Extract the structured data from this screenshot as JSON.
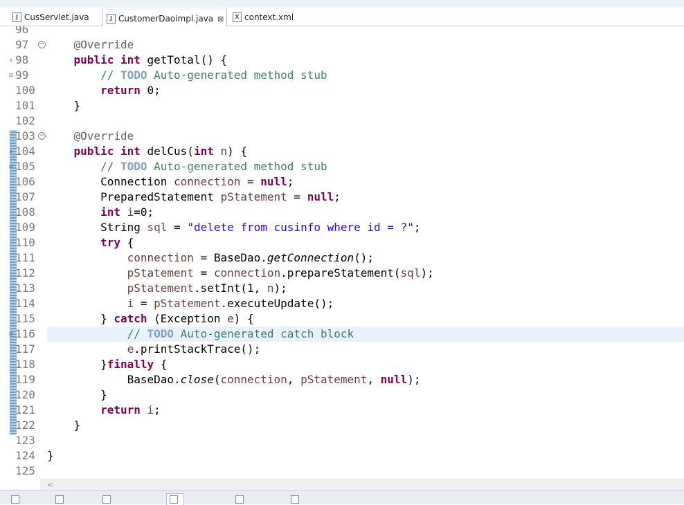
{
  "tabs": [
    {
      "label": "CusServlet.java",
      "icon": "java-file-icon",
      "active": false
    },
    {
      "label": "CustomerDaoimpl.java",
      "icon": "java-file-icon",
      "active": true,
      "close": "⊠"
    },
    {
      "label": "context.xml",
      "icon": "xml-file-icon",
      "active": false
    }
  ],
  "editor": {
    "current_line": "116",
    "lines": [
      {
        "num": "96",
        "code": ""
      },
      {
        "num": "97",
        "fold": "−",
        "tokens": [
          {
            "t": "    "
          },
          {
            "t": "@Override",
            "c": "an"
          }
        ]
      },
      {
        "num": "98",
        "marker": "▵",
        "tokens": [
          {
            "t": "    "
          },
          {
            "t": "public",
            "c": "kw"
          },
          {
            "t": " "
          },
          {
            "t": "int",
            "c": "kw"
          },
          {
            "t": " getTotal() {"
          }
        ]
      },
      {
        "num": "99",
        "marker": "☑",
        "tokens": [
          {
            "t": "        "
          },
          {
            "t": "// ",
            "c": "cm"
          },
          {
            "t": "TODO",
            "c": "todo"
          },
          {
            "t": " Auto-generated method stub",
            "c": "cm"
          }
        ]
      },
      {
        "num": "100",
        "tokens": [
          {
            "t": "        "
          },
          {
            "t": "return",
            "c": "kw"
          },
          {
            "t": " 0;"
          }
        ]
      },
      {
        "num": "101",
        "tokens": [
          {
            "t": "    }"
          }
        ]
      },
      {
        "num": "102",
        "tokens": []
      },
      {
        "num": "103",
        "fold": "−",
        "tokens": [
          {
            "t": "    "
          },
          {
            "t": "@Override",
            "c": "an"
          }
        ]
      },
      {
        "num": "104",
        "marker": "▵",
        "tokens": [
          {
            "t": "    "
          },
          {
            "t": "public",
            "c": "kw"
          },
          {
            "t": " "
          },
          {
            "t": "int",
            "c": "kw"
          },
          {
            "t": " delCus("
          },
          {
            "t": "int",
            "c": "kw"
          },
          {
            "t": " "
          },
          {
            "t": "n",
            "c": "va"
          },
          {
            "t": ") {"
          }
        ]
      },
      {
        "num": "105",
        "marker": "☑",
        "tokens": [
          {
            "t": "        "
          },
          {
            "t": "// ",
            "c": "cm"
          },
          {
            "t": "TODO",
            "c": "todo"
          },
          {
            "t": " Auto-generated method stub",
            "c": "cm"
          }
        ]
      },
      {
        "num": "106",
        "tokens": [
          {
            "t": "        Connection "
          },
          {
            "t": "connection",
            "c": "va"
          },
          {
            "t": " = "
          },
          {
            "t": "null",
            "c": "kw"
          },
          {
            "t": ";"
          }
        ]
      },
      {
        "num": "107",
        "tokens": [
          {
            "t": "        PreparedStatement "
          },
          {
            "t": "pStatement",
            "c": "va"
          },
          {
            "t": " = "
          },
          {
            "t": "null",
            "c": "kw"
          },
          {
            "t": ";"
          }
        ]
      },
      {
        "num": "108",
        "tokens": [
          {
            "t": "        "
          },
          {
            "t": "int",
            "c": "kw"
          },
          {
            "t": " "
          },
          {
            "t": "i",
            "c": "va"
          },
          {
            "t": "=0;"
          }
        ]
      },
      {
        "num": "109",
        "tokens": [
          {
            "t": "        String "
          },
          {
            "t": "sql",
            "c": "va"
          },
          {
            "t": " = "
          },
          {
            "t": "\"delete from cusinfo where id = ?\"",
            "c": "st"
          },
          {
            "t": ";"
          }
        ]
      },
      {
        "num": "110",
        "tokens": [
          {
            "t": "        "
          },
          {
            "t": "try",
            "c": "kw"
          },
          {
            "t": " {"
          }
        ]
      },
      {
        "num": "111",
        "tokens": [
          {
            "t": "            "
          },
          {
            "t": "connection",
            "c": "va"
          },
          {
            "t": " = BaseDao."
          },
          {
            "t": "getConnection",
            "c": "sm"
          },
          {
            "t": "();"
          }
        ]
      },
      {
        "num": "112",
        "tokens": [
          {
            "t": "            "
          },
          {
            "t": "pStatement",
            "c": "va"
          },
          {
            "t": " = "
          },
          {
            "t": "connection",
            "c": "va"
          },
          {
            "t": ".prepareStatement("
          },
          {
            "t": "sql",
            "c": "va"
          },
          {
            "t": ");"
          }
        ]
      },
      {
        "num": "113",
        "tokens": [
          {
            "t": "            "
          },
          {
            "t": "pStatement",
            "c": "va"
          },
          {
            "t": ".setInt(1, "
          },
          {
            "t": "n",
            "c": "va"
          },
          {
            "t": ");"
          }
        ]
      },
      {
        "num": "114",
        "tokens": [
          {
            "t": "            "
          },
          {
            "t": "i",
            "c": "va"
          },
          {
            "t": " = "
          },
          {
            "t": "pStatement",
            "c": "va"
          },
          {
            "t": ".executeUpdate();"
          }
        ]
      },
      {
        "num": "115",
        "tokens": [
          {
            "t": "        } "
          },
          {
            "t": "catch",
            "c": "kw"
          },
          {
            "t": " (Exception "
          },
          {
            "t": "e",
            "c": "va"
          },
          {
            "t": ") {"
          }
        ]
      },
      {
        "num": "116",
        "marker": "☑",
        "tokens": [
          {
            "t": "            "
          },
          {
            "t": "// ",
            "c": "cm"
          },
          {
            "t": "TODO",
            "c": "todo"
          },
          {
            "t": " Auto-generated catch block",
            "c": "cm"
          }
        ]
      },
      {
        "num": "117",
        "tokens": [
          {
            "t": "            "
          },
          {
            "t": "e",
            "c": "va"
          },
          {
            "t": ".printStackTrace();"
          }
        ]
      },
      {
        "num": "118",
        "tokens": [
          {
            "t": "        }"
          },
          {
            "t": "finally",
            "c": "kw"
          },
          {
            "t": " {"
          }
        ]
      },
      {
        "num": "119",
        "tokens": [
          {
            "t": "            BaseDao."
          },
          {
            "t": "close",
            "c": "sm"
          },
          {
            "t": "("
          },
          {
            "t": "connection",
            "c": "va"
          },
          {
            "t": ", "
          },
          {
            "t": "pStatement",
            "c": "va"
          },
          {
            "t": ", "
          },
          {
            "t": "null",
            "c": "kw"
          },
          {
            "t": ");"
          }
        ]
      },
      {
        "num": "120",
        "tokens": [
          {
            "t": "        }"
          }
        ]
      },
      {
        "num": "121",
        "tokens": [
          {
            "t": "        "
          },
          {
            "t": "return",
            "c": "kw"
          },
          {
            "t": " "
          },
          {
            "t": "i",
            "c": "va"
          },
          {
            "t": ";"
          }
        ]
      },
      {
        "num": "122",
        "tokens": [
          {
            "t": "    }"
          }
        ]
      },
      {
        "num": "123",
        "tokens": []
      },
      {
        "num": "124",
        "tokens": [
          {
            "t": "}"
          }
        ]
      },
      {
        "num": "125",
        "tokens": []
      }
    ]
  },
  "scrollbar": {
    "left_arrow": "<"
  },
  "colors": {
    "keyword": "#7f0055",
    "comment": "#3f7f5f",
    "string": "#2a00ff",
    "variable": "#6a3e3e",
    "annotation": "#646464",
    "current_line": "#e8f2fe"
  }
}
